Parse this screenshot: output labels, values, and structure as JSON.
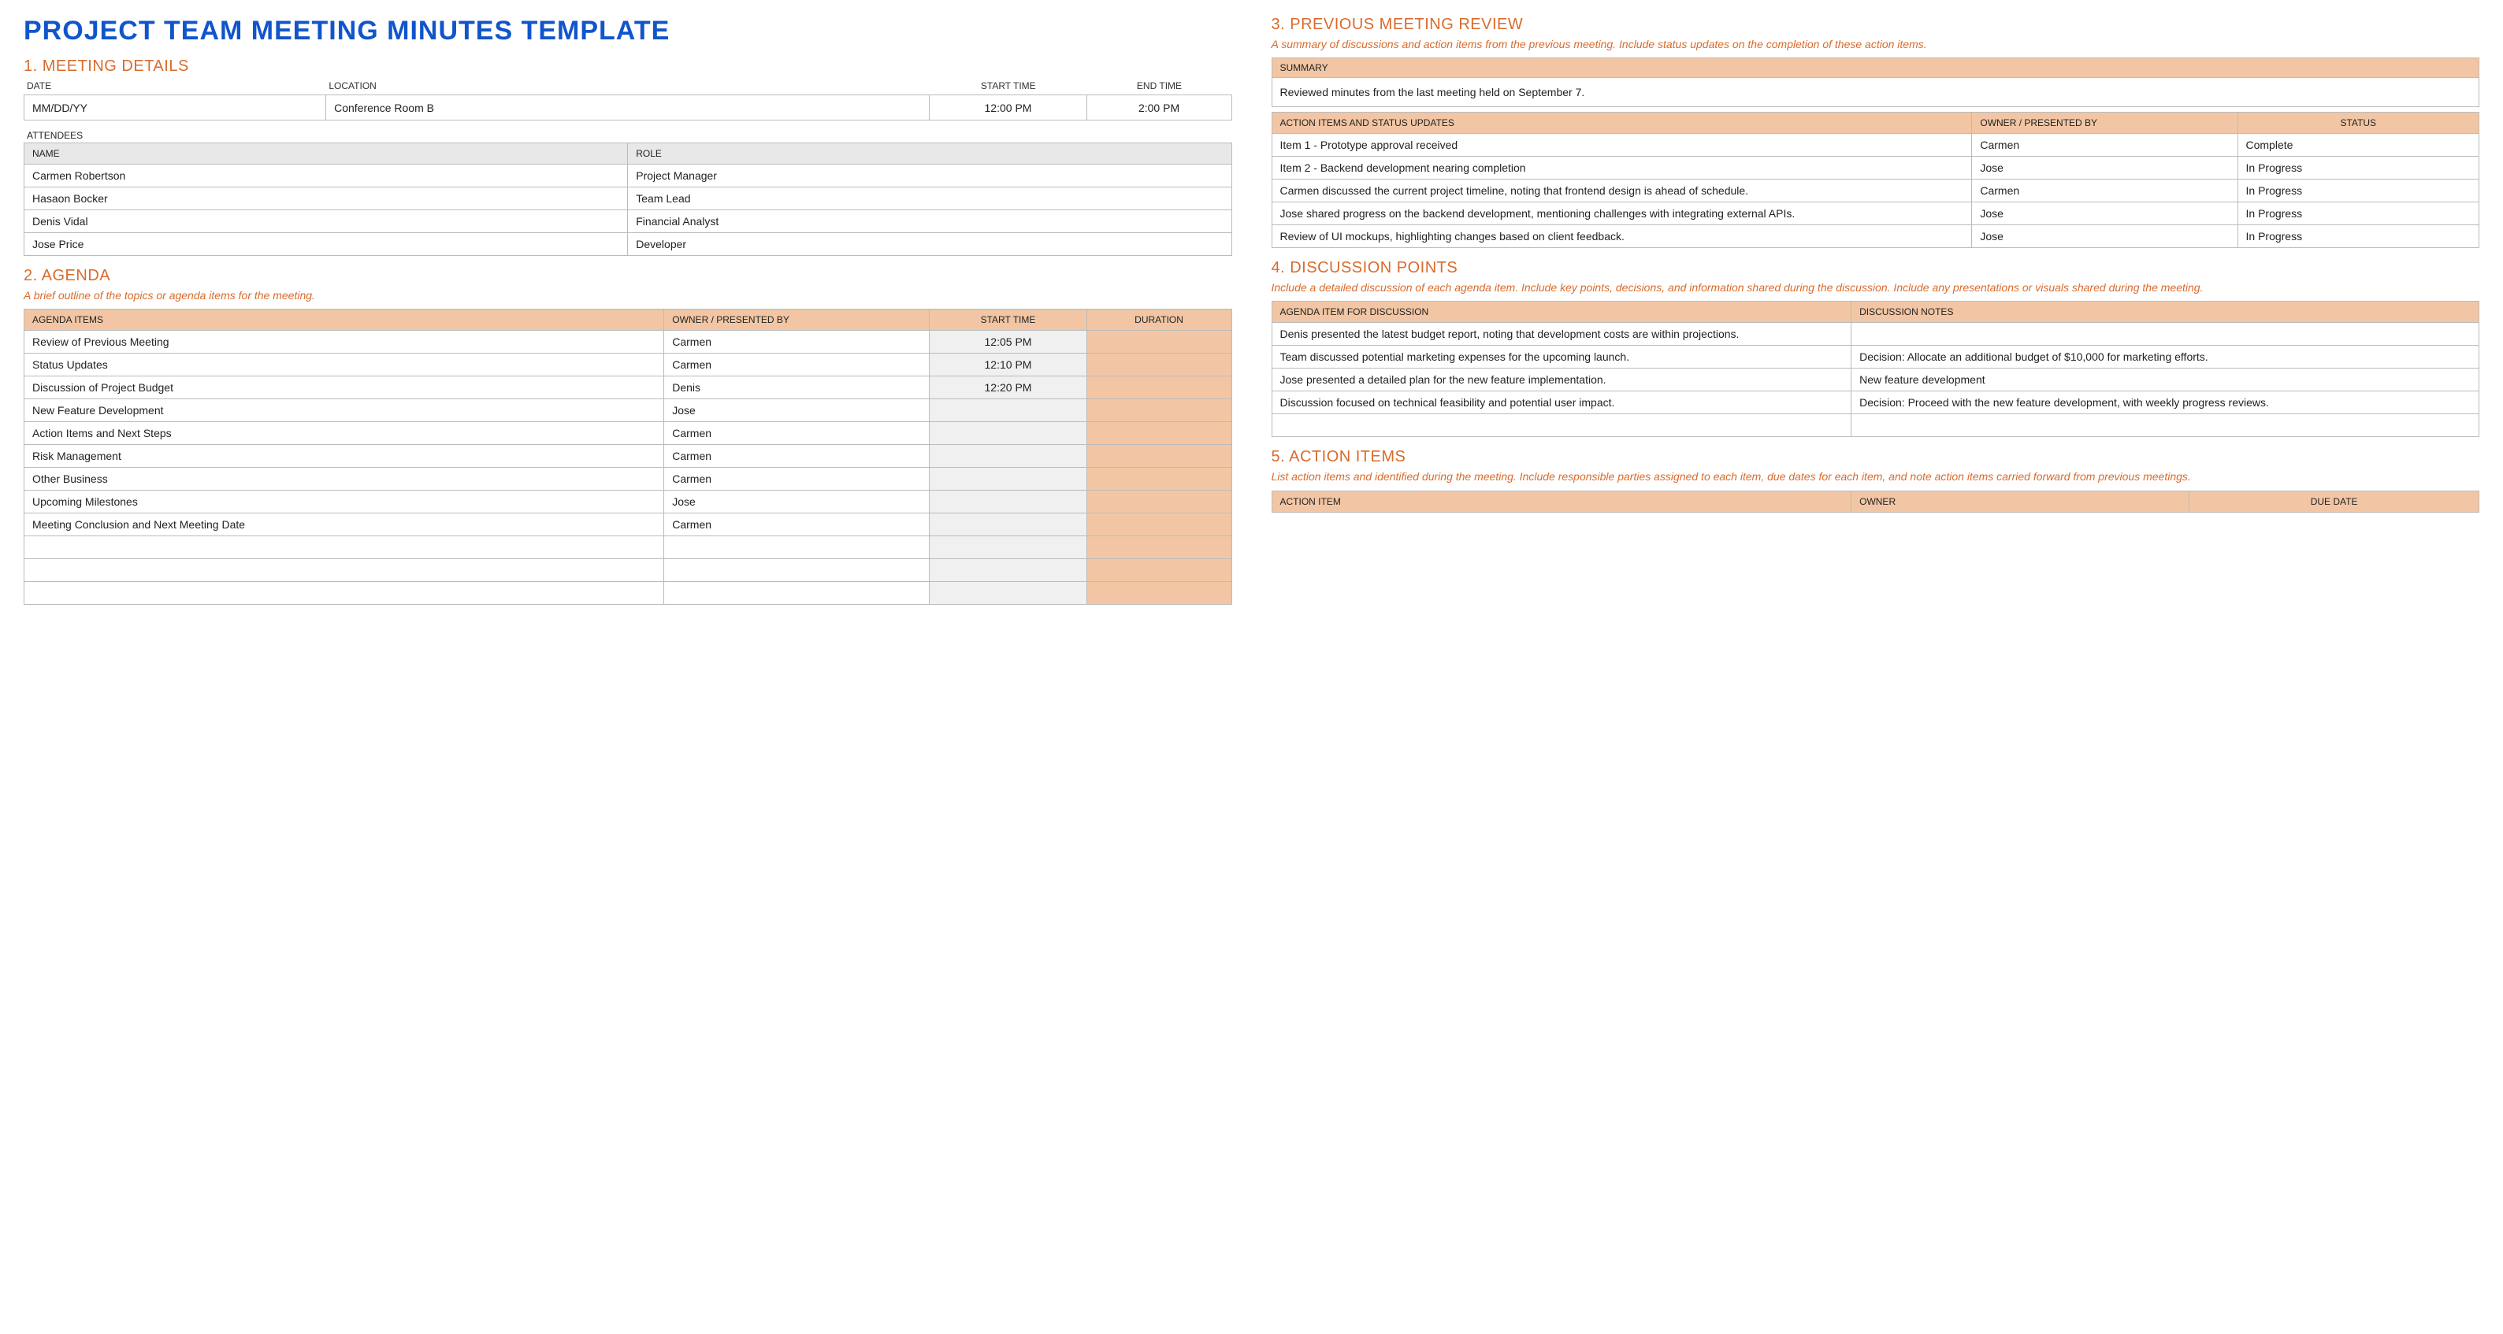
{
  "title": "PROJECT TEAM MEETING MINUTES TEMPLATE",
  "s1": {
    "heading": "1. MEETING DETAILS",
    "labels": {
      "date": "DATE",
      "location": "LOCATION",
      "start": "START TIME",
      "end": "END TIME"
    },
    "values": {
      "date": "MM/DD/YY",
      "location": "Conference Room B",
      "start": "12:00 PM",
      "end": "2:00 PM"
    },
    "attendees_label": "ATTENDEES",
    "attendees_headers": {
      "name": "NAME",
      "role": "ROLE"
    },
    "attendees": [
      {
        "name": "Carmen Robertson",
        "role": "Project Manager"
      },
      {
        "name": "Hasaon Bocker",
        "role": "Team Lead"
      },
      {
        "name": "Denis Vidal",
        "role": "Financial Analyst"
      },
      {
        "name": "Jose Price",
        "role": "Developer"
      }
    ]
  },
  "s2": {
    "heading": "2. AGENDA",
    "desc": "A brief outline of the topics or agenda items for the meeting.",
    "headers": {
      "item": "AGENDA ITEMS",
      "owner": "OWNER / PRESENTED BY",
      "start": "START TIME",
      "dur": "DURATION"
    },
    "rows": [
      {
        "item": "Review of Previous Meeting",
        "owner": "Carmen",
        "start": "12:05 PM",
        "dur": ""
      },
      {
        "item": "Status Updates",
        "owner": "Carmen",
        "start": "12:10 PM",
        "dur": ""
      },
      {
        "item": "Discussion of Project Budget",
        "owner": "Denis",
        "start": "12:20 PM",
        "dur": ""
      },
      {
        "item": "New Feature Development",
        "owner": "Jose",
        "start": "",
        "dur": ""
      },
      {
        "item": "Action Items and Next Steps",
        "owner": "Carmen",
        "start": "",
        "dur": ""
      },
      {
        "item": "Risk Management",
        "owner": "Carmen",
        "start": "",
        "dur": ""
      },
      {
        "item": "Other Business",
        "owner": "Carmen",
        "start": "",
        "dur": ""
      },
      {
        "item": "Upcoming Milestones",
        "owner": "Jose",
        "start": "",
        "dur": ""
      },
      {
        "item": "Meeting Conclusion and Next Meeting Date",
        "owner": "Carmen",
        "start": "",
        "dur": ""
      },
      {
        "item": "",
        "owner": "",
        "start": "",
        "dur": ""
      },
      {
        "item": "",
        "owner": "",
        "start": "",
        "dur": ""
      },
      {
        "item": "",
        "owner": "",
        "start": "",
        "dur": ""
      }
    ]
  },
  "s3": {
    "heading": "3. PREVIOUS MEETING REVIEW",
    "desc": "A summary of discussions and action items from the previous meeting. Include status updates on the completion of these action items.",
    "summary_label": "SUMMARY",
    "summary_text": "Reviewed minutes from the last meeting held on September 7.",
    "headers": {
      "item": "ACTION ITEMS AND STATUS UPDATES",
      "owner": "OWNER / PRESENTED BY",
      "status": "STATUS"
    },
    "rows": [
      {
        "item": "Item 1 - Prototype approval received",
        "owner": "Carmen",
        "status": "Complete"
      },
      {
        "item": "Item 2 - Backend development nearing completion",
        "owner": "Jose",
        "status": "In Progress"
      },
      {
        "item": "Carmen discussed the current project timeline, noting that frontend design is ahead of schedule.",
        "owner": "Carmen",
        "status": "In Progress"
      },
      {
        "item": "Jose shared progress on the backend development, mentioning challenges with integrating external APIs.",
        "owner": "Jose",
        "status": "In Progress"
      },
      {
        "item": "Review of UI mockups, highlighting changes based on client feedback.",
        "owner": "Jose",
        "status": "In Progress"
      }
    ]
  },
  "s4": {
    "heading": "4. DISCUSSION POINTS",
    "desc": "Include a detailed discussion of each agenda item. Include key points, decisions, and information shared during the discussion. Include any presentations or visuals shared during the meeting.",
    "headers": {
      "item": "AGENDA ITEM FOR DISCUSSION",
      "notes": "DISCUSSION NOTES"
    },
    "rows": [
      {
        "item": "Denis presented the latest budget report, noting that development costs are within projections.",
        "notes": ""
      },
      {
        "item": "Team discussed potential marketing expenses for the upcoming launch.",
        "notes": "Decision: Allocate an additional budget of $10,000 for marketing efforts."
      },
      {
        "item": "Jose presented a detailed plan for the new feature implementation.",
        "notes": "New feature development"
      },
      {
        "item": "Discussion focused on technical feasibility and potential user impact.",
        "notes": "Decision: Proceed with the new feature development, with weekly progress reviews."
      },
      {
        "item": "",
        "notes": ""
      }
    ]
  },
  "s5": {
    "heading": "5. ACTION ITEMS",
    "desc": "List action items and identified during the meeting. Include responsible parties assigned to each item, due dates for each item, and note action items carried forward from previous meetings.",
    "headers": {
      "item": "ACTION ITEM",
      "owner": "OWNER",
      "due": "DUE DATE"
    }
  }
}
